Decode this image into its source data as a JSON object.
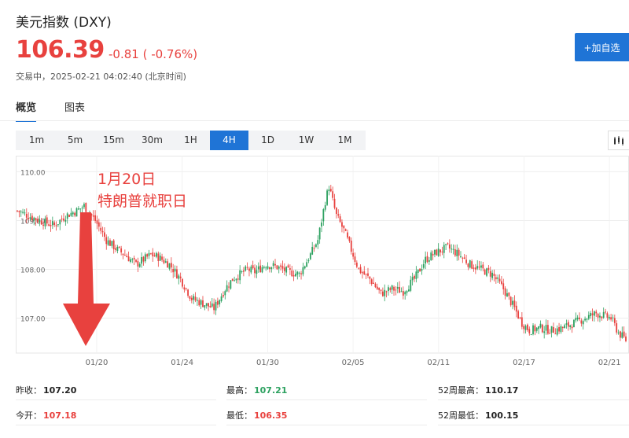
{
  "header": {
    "title": "美元指数 (DXY)",
    "price": "106.39",
    "change": "-0.81 ( -0.76%)",
    "status": "交易中，2025-02-21 04:02:40 (北京时间)",
    "add_button": "+加自选"
  },
  "tabs": [
    {
      "label": "概览",
      "active": true
    },
    {
      "label": "图表",
      "active": false
    }
  ],
  "periods": [
    {
      "label": "1m",
      "active": false
    },
    {
      "label": "5m",
      "active": false
    },
    {
      "label": "15m",
      "active": false
    },
    {
      "label": "30m",
      "active": false
    },
    {
      "label": "1H",
      "active": false
    },
    {
      "label": "4H",
      "active": true
    },
    {
      "label": "1D",
      "active": false
    },
    {
      "label": "1W",
      "active": false
    },
    {
      "label": "1M",
      "active": false
    }
  ],
  "stats": {
    "prev_close": {
      "label": "昨收：",
      "value": "107.20"
    },
    "open": {
      "label": "今开：",
      "value": "107.18"
    },
    "high": {
      "label": "最高：",
      "value": "107.21"
    },
    "low": {
      "label": "最低：",
      "value": "106.35"
    },
    "high52": {
      "label": "52周最高：",
      "value": "110.17"
    },
    "low52": {
      "label": "52周最低：",
      "value": "100.15"
    }
  },
  "colors": {
    "up": "#2da160",
    "down": "#e8413e",
    "accent": "#1f74d6"
  },
  "chart_data": {
    "type": "candlestick",
    "ylim": [
      106.3,
      110.2
    ],
    "y_ticks": [
      {
        "value": 110,
        "label": "110.00"
      },
      {
        "value": 109,
        "label": "109.00"
      },
      {
        "value": 108,
        "label": "108.00"
      },
      {
        "value": 107,
        "label": "107.00"
      }
    ],
    "x_ticks": [
      "01/20",
      "01/24",
      "01/30",
      "02/05",
      "02/11",
      "02/17",
      "02/21"
    ],
    "annotation": {
      "lines": [
        "1月20日",
        "特朗普就职日"
      ],
      "arrow_color": "#e8413e"
    },
    "path": [
      [
        0,
        109.2
      ],
      [
        6,
        109.1
      ],
      [
        12,
        109.0
      ],
      [
        20,
        108.9
      ],
      [
        26,
        109.1
      ],
      [
        32,
        109.2
      ],
      [
        36,
        109.3
      ],
      [
        42,
        109.0
      ],
      [
        48,
        108.6
      ],
      [
        54,
        108.4
      ],
      [
        58,
        108.3
      ],
      [
        64,
        108.1
      ],
      [
        68,
        108.2
      ],
      [
        72,
        108.3
      ],
      [
        76,
        108.25
      ],
      [
        82,
        108.1
      ],
      [
        88,
        107.8
      ],
      [
        94,
        107.4
      ],
      [
        100,
        107.3
      ],
      [
        106,
        107.2
      ],
      [
        112,
        107.6
      ],
      [
        116,
        107.8
      ],
      [
        120,
        107.9
      ],
      [
        124,
        108.0
      ],
      [
        128,
        107.95
      ],
      [
        134,
        108.1
      ],
      [
        140,
        108.05
      ],
      [
        146,
        107.95
      ],
      [
        152,
        107.9
      ],
      [
        158,
        108.3
      ],
      [
        162,
        108.6
      ],
      [
        166,
        109.4
      ],
      [
        168,
        109.7
      ],
      [
        172,
        109.1
      ],
      [
        176,
        108.8
      ],
      [
        180,
        108.4
      ],
      [
        184,
        108.0
      ],
      [
        190,
        107.8
      ],
      [
        196,
        107.5
      ],
      [
        202,
        107.6
      ],
      [
        208,
        107.55
      ],
      [
        214,
        107.8
      ],
      [
        220,
        108.2
      ],
      [
        226,
        108.35
      ],
      [
        232,
        108.45
      ],
      [
        238,
        108.3
      ],
      [
        244,
        108.1
      ],
      [
        250,
        108.0
      ],
      [
        256,
        107.9
      ],
      [
        262,
        107.6
      ],
      [
        268,
        107.2
      ],
      [
        272,
        106.9
      ],
      [
        276,
        106.75
      ],
      [
        282,
        106.8
      ],
      [
        288,
        106.75
      ],
      [
        294,
        106.8
      ],
      [
        300,
        106.9
      ],
      [
        306,
        107.0
      ],
      [
        312,
        107.1
      ],
      [
        316,
        107.05
      ],
      [
        320,
        107.0
      ],
      [
        324,
        106.7
      ],
      [
        328,
        106.55
      ]
    ]
  }
}
